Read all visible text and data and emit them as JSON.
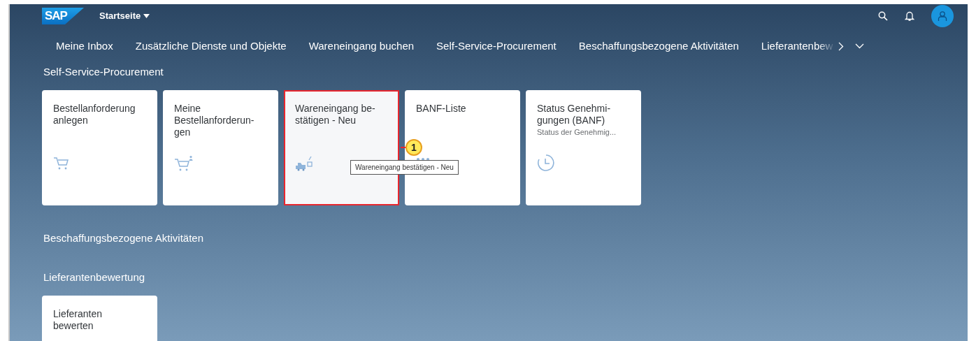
{
  "shell": {
    "logo": "SAP",
    "title": "Startseite"
  },
  "nav": [
    {
      "label": "Meine Inbox",
      "selected": false
    },
    {
      "label": "Zusätzliche Dienste und Objekte",
      "selected": false
    },
    {
      "label": "Wareneingang buchen",
      "selected": false
    },
    {
      "label": "Self-Service-Procurement",
      "selected": false
    },
    {
      "label": "Beschaffungsbezogene Aktivitäten",
      "selected": false
    },
    {
      "label": "Lieferantenbew",
      "selected": false
    }
  ],
  "sections": [
    {
      "title": "Self-Service-Procurement",
      "tiles": [
        {
          "title": "Bestellanforderung\nanlegen",
          "kind": "cart",
          "highlighted": false
        },
        {
          "title": "Meine\nBestellanforderun-\ngen",
          "kind": "cart-person",
          "highlighted": false
        },
        {
          "title": "Wareneingang be-\nstätigen - Neu",
          "kind": "truck",
          "highlighted": true
        },
        {
          "title": "BANF-Liste",
          "kind": "list",
          "highlighted": false
        },
        {
          "title": "Status Genehmi-\ngungen (BANF)",
          "subtitle": "Status der Genehmig...",
          "kind": "clock",
          "highlighted": false
        }
      ]
    },
    {
      "title": "Beschaffungsbezogene Aktivitäten"
    },
    {
      "title": "Lieferantenbewertung",
      "tiles": [
        {
          "title": "Lieferanten\nbewerten",
          "highlighted": false
        }
      ]
    }
  ],
  "tooltip": "Wareneingang bestätigen - Neu",
  "callout": "1"
}
